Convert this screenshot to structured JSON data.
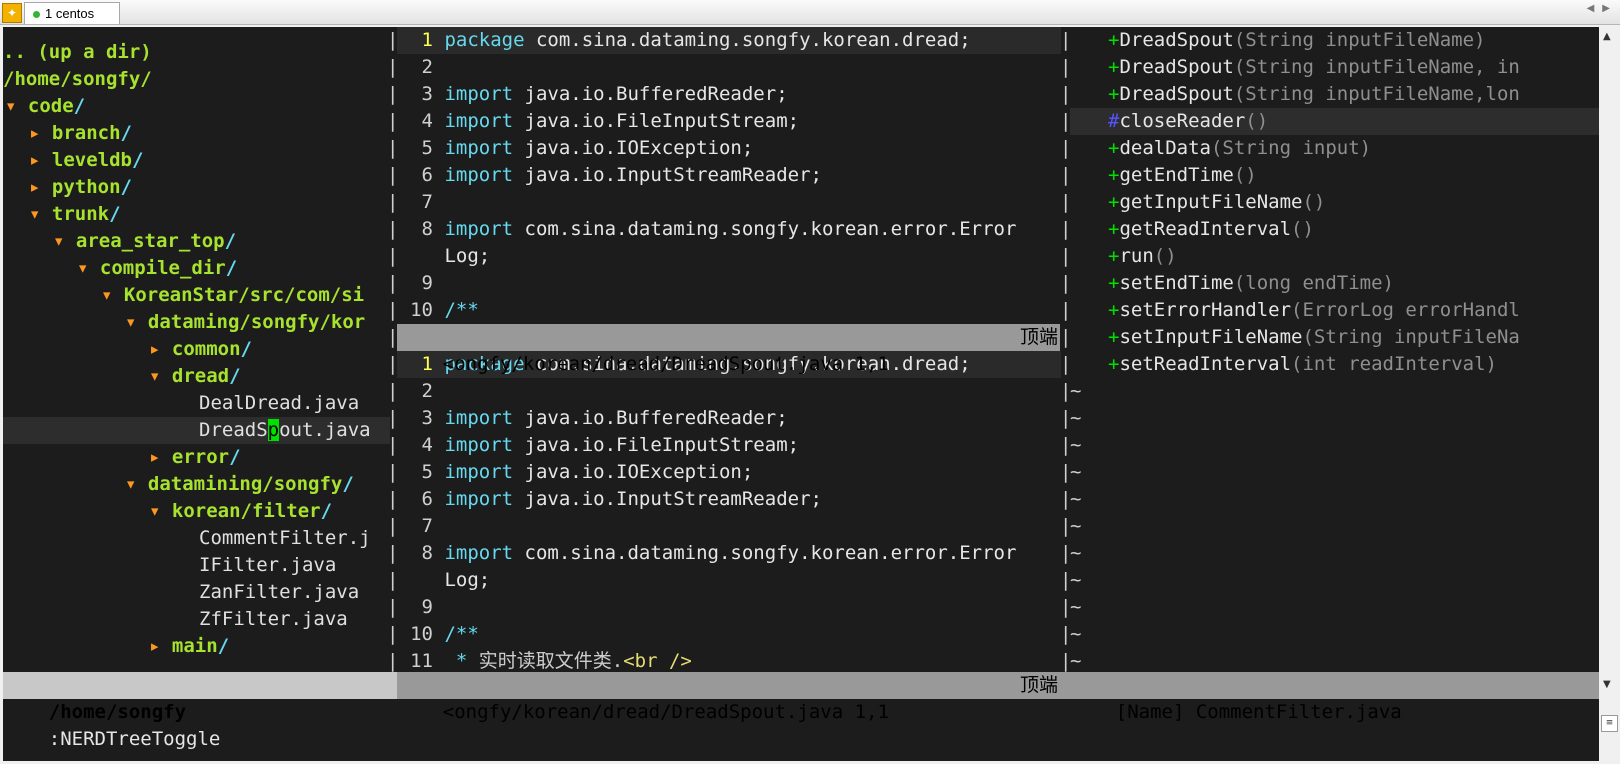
{
  "tabbar": {
    "tab_label": "1 centos",
    "scroll_left": "◀",
    "scroll_right": "▶"
  },
  "nerdtree": {
    "rows": [
      {
        "text": ".. (up a dir)",
        "kind": "dir",
        "indent": 0,
        "arrow": ""
      },
      {
        "text": "/home/songfy/",
        "kind": "root",
        "indent": 0,
        "arrow": ""
      },
      {
        "text": "code/",
        "kind": "dir",
        "indent": 0,
        "arrow": "▾"
      },
      {
        "text": "branch/",
        "kind": "dir",
        "indent": 1,
        "arrow": "▸"
      },
      {
        "text": "leveldb/",
        "kind": "dir",
        "indent": 1,
        "arrow": "▸"
      },
      {
        "text": "python/",
        "kind": "dir",
        "indent": 1,
        "arrow": "▸"
      },
      {
        "text": "trunk/",
        "kind": "dir",
        "indent": 1,
        "arrow": "▾"
      },
      {
        "text": "area_star_top/",
        "kind": "dir",
        "indent": 2,
        "arrow": "▾"
      },
      {
        "text": "compile_dir/",
        "kind": "dir",
        "indent": 3,
        "arrow": "▾"
      },
      {
        "text": "KoreanStar/src/com/si",
        "kind": "dir",
        "indent": 4,
        "arrow": "▾"
      },
      {
        "text": "dataming/songfy/kor",
        "kind": "dir",
        "indent": 5,
        "arrow": "▾"
      },
      {
        "text": "common/",
        "kind": "dir",
        "indent": 6,
        "arrow": "▸"
      },
      {
        "text": "dread/",
        "kind": "dir",
        "indent": 6,
        "arrow": "▾"
      },
      {
        "text": "DealDread.java",
        "kind": "file",
        "indent": 7,
        "arrow": ""
      },
      {
        "text": "DreadSpout.java",
        "kind": "file-selected",
        "indent": 7,
        "arrow": ""
      },
      {
        "text": "error/",
        "kind": "dir",
        "indent": 6,
        "arrow": "▸"
      },
      {
        "text": "datamining/songfy/",
        "kind": "dir",
        "indent": 5,
        "arrow": "▾"
      },
      {
        "text": "korean/filter/",
        "kind": "dir",
        "indent": 6,
        "arrow": "▾"
      },
      {
        "text": "CommentFilter.j",
        "kind": "file",
        "indent": 7,
        "arrow": ""
      },
      {
        "text": "IFilter.java",
        "kind": "file",
        "indent": 7,
        "arrow": ""
      },
      {
        "text": "ZanFilter.java",
        "kind": "file",
        "indent": 7,
        "arrow": ""
      },
      {
        "text": "ZfFilter.java",
        "kind": "file",
        "indent": 7,
        "arrow": ""
      },
      {
        "text": "main/",
        "kind": "dir",
        "indent": 6,
        "arrow": "▸"
      }
    ],
    "status": "/home/songfy"
  },
  "editor_top": {
    "lines": [
      {
        "n": "1",
        "kw": "package",
        "rest": " com.sina.dataming.songfy.korean.dread;",
        "current": true
      },
      {
        "n": "2",
        "kw": "",
        "rest": ""
      },
      {
        "n": "3",
        "kw": "import",
        "rest": " java.io.BufferedReader;"
      },
      {
        "n": "4",
        "kw": "import",
        "rest": " java.io.FileInputStream;"
      },
      {
        "n": "5",
        "kw": "import",
        "rest": " java.io.IOException;"
      },
      {
        "n": "6",
        "kw": "import",
        "rest": " java.io.InputStreamReader;"
      },
      {
        "n": "7",
        "kw": "",
        "rest": ""
      },
      {
        "n": "8",
        "kw": "import",
        "rest": " com.sina.dataming.songfy.korean.error.Error"
      },
      {
        "n": "",
        "kw": "",
        "rest": "Log;"
      },
      {
        "n": "9",
        "kw": "",
        "rest": ""
      },
      {
        "n": "10",
        "kw": "",
        "rest": "",
        "comment": "/**"
      }
    ],
    "status_file": "<ongfy/korean/dread/DreadSpout.java 1,1",
    "status_pos": "顶端"
  },
  "editor_bottom": {
    "lines": [
      {
        "n": "1",
        "kw": "package",
        "rest": " com.sina.dataming.songfy.korean.dread;",
        "current": true
      },
      {
        "n": "2",
        "kw": "",
        "rest": ""
      },
      {
        "n": "3",
        "kw": "import",
        "rest": " java.io.BufferedReader;"
      },
      {
        "n": "4",
        "kw": "import",
        "rest": " java.io.FileInputStream;"
      },
      {
        "n": "5",
        "kw": "import",
        "rest": " java.io.IOException;"
      },
      {
        "n": "6",
        "kw": "import",
        "rest": " java.io.InputStreamReader;"
      },
      {
        "n": "7",
        "kw": "",
        "rest": ""
      },
      {
        "n": "8",
        "kw": "import",
        "rest": " com.sina.dataming.songfy.korean.error.Error"
      },
      {
        "n": "",
        "kw": "",
        "rest": "Log;"
      },
      {
        "n": "9",
        "kw": "",
        "rest": ""
      },
      {
        "n": "10",
        "kw": "",
        "rest": "",
        "comment": "/**"
      },
      {
        "n": "11",
        "kw": "",
        "rest": "",
        "comment": " * ",
        "cn": "实时读取文件类.",
        "tag": "<br />"
      }
    ],
    "status_file": "<ongfy/korean/dread/DreadSpout.java 1,1",
    "status_pos": "顶端"
  },
  "taglist": {
    "items": [
      {
        "sym": "+",
        "name": "DreadSpout",
        "args": "(String inputFileName)"
      },
      {
        "sym": "+",
        "name": "DreadSpout",
        "args": "(String inputFileName, in"
      },
      {
        "sym": "+",
        "name": "DreadSpout",
        "args": "(String inputFileName,lon"
      },
      {
        "sym": "#",
        "name": "closeReader",
        "args": "()",
        "selected": true
      },
      {
        "sym": "+",
        "name": "dealData",
        "args": "(String input)"
      },
      {
        "sym": "+",
        "name": "getEndTime",
        "args": "()"
      },
      {
        "sym": "+",
        "name": "getInputFileName",
        "args": "()"
      },
      {
        "sym": "+",
        "name": "getReadInterval",
        "args": "()"
      },
      {
        "sym": "+",
        "name": "run",
        "args": "()"
      },
      {
        "sym": "+",
        "name": "setEndTime",
        "args": "(long endTime)"
      },
      {
        "sym": "+",
        "name": "setErrorHandler",
        "args": "(ErrorLog errorHandl"
      },
      {
        "sym": "+",
        "name": "setInputFileName",
        "args": "(String inputFileNa"
      },
      {
        "sym": "+",
        "name": "setReadInterval",
        "args": "(int readInterval)"
      }
    ],
    "tildes": [
      "~",
      "~",
      "~",
      "~",
      "~",
      "~",
      "~",
      "~",
      "~",
      "~",
      "~",
      "~"
    ],
    "status": "[Name] CommentFilter.java"
  },
  "cmdline": ":NERDTreeToggle",
  "colors": {
    "terminal_bg": "#1c1c1c",
    "dir": "#a6e22e",
    "arrow": "#fd971f",
    "keyword": "#66d9ef",
    "current_line_number": "#ffff55",
    "tag_public": "#00e000",
    "tag_protected": "#5555ff",
    "status_bg": "#999999"
  }
}
